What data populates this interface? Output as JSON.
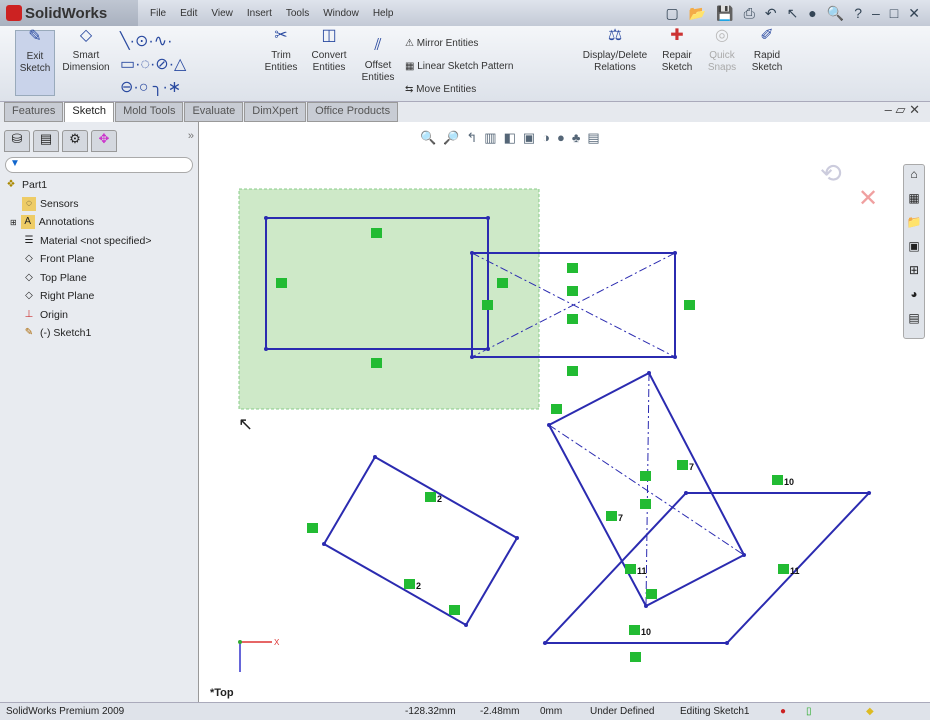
{
  "app": {
    "title": "SolidWorks"
  },
  "menu": [
    "File",
    "Edit",
    "View",
    "Insert",
    "Tools",
    "Window",
    "Help"
  ],
  "ribbon": {
    "exit_sketch": "Exit Sketch",
    "smart_dimension": "Smart Dimension",
    "trim": "Trim Entities",
    "convert": "Convert Entities",
    "offset": "Offset Entities",
    "mirror": "Mirror Entities",
    "linear_pattern": "Linear Sketch Pattern",
    "move": "Move Entities",
    "display_relations": "Display/Delete Relations",
    "repair": "Repair Sketch",
    "quick_snaps": "Quick Snaps",
    "rapid": "Rapid Sketch"
  },
  "tabs": [
    "Features",
    "Sketch",
    "Mold Tools",
    "Evaluate",
    "DimXpert",
    "Office Products"
  ],
  "tree": [
    "Part1",
    "Sensors",
    "Annotations",
    "Material <not specified>",
    "Front Plane",
    "Top Plane",
    "Right Plane",
    "Origin",
    "(-) Sketch1"
  ],
  "view": {
    "orientation": "*Top"
  },
  "relations": {
    "r2": "2",
    "r7": "7",
    "r10": "10",
    "r11": "11"
  },
  "status": {
    "product": "SolidWorks Premium 2009",
    "x": "-128.32mm",
    "y": "-2.48mm",
    "z": "0mm",
    "state": "Under Defined",
    "editing": "Editing Sketch1"
  },
  "colors": {
    "sketch": "#2b2bb0",
    "selection": "#b9e0b0",
    "relation": "#22bb33"
  }
}
